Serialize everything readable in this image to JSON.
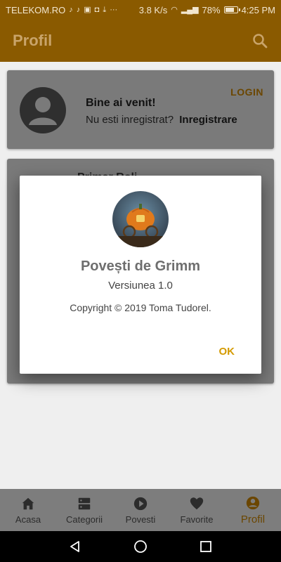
{
  "status_bar": {
    "carrier": "TELEKOM.RO",
    "speed": "3.8 K/s",
    "battery_percent": "78%",
    "battery_level": 0.78,
    "time": "4:25 PM",
    "icons": [
      "music-note-icon",
      "music-note-icon",
      "image-icon",
      "shield-icon",
      "download-icon",
      "more-dots-icon",
      "wifi-icon",
      "signal-icon",
      "battery-icon"
    ]
  },
  "app_bar": {
    "title": "Profil",
    "search_icon": "search-icon"
  },
  "profile_card": {
    "welcome": "Bine ai venit!",
    "not_registered": "Nu esti inregistrat?",
    "register_link": "Inregistrare",
    "login_button": "LOGIN"
  },
  "second_card": {
    "peek_text": "Primar Roli"
  },
  "dialog": {
    "title": "Povești de Grimm",
    "version": "Versiunea 1.0",
    "copyright": "Copyright © 2019 Toma Tudorel.",
    "ok_button": "OK"
  },
  "bottom_nav": {
    "items": [
      {
        "label": "Acasa",
        "icon": "home-icon"
      },
      {
        "label": "Categorii",
        "icon": "categories-icon"
      },
      {
        "label": "Povesti",
        "icon": "play-icon"
      },
      {
        "label": "Favorite",
        "icon": "heart-icon"
      },
      {
        "label": "Profil",
        "icon": "account-icon"
      }
    ],
    "active": "Profil"
  },
  "colors": {
    "primary_dark": "#8a5a00",
    "accent": "#d49a00",
    "dialog_bg": "#ffffff"
  }
}
